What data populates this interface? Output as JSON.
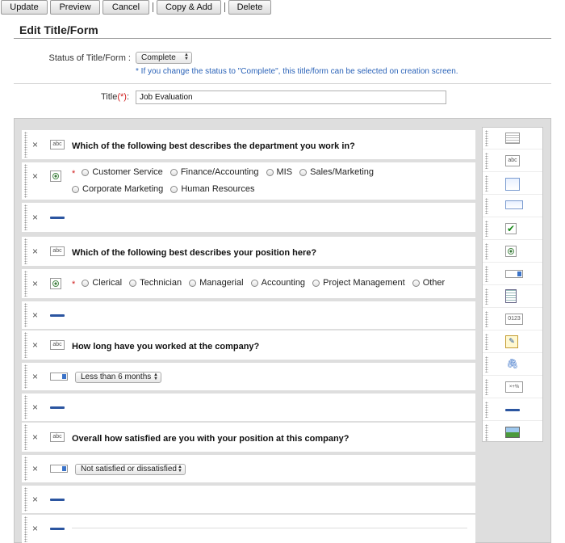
{
  "toolbar": {
    "update": "Update",
    "preview": "Preview",
    "cancel": "Cancel",
    "copy_add": "Copy & Add",
    "delete": "Delete"
  },
  "header": {
    "title": "Edit Title/Form"
  },
  "status": {
    "label": "Status of Title/Form :",
    "value": "Complete",
    "note": "* If you change the status to \"Complete\", this title/form can be selected on creation screen."
  },
  "title_field": {
    "label": "Title",
    "required_mark": "(*)",
    "colon": ":",
    "value": "Job Evaluation"
  },
  "icons": {
    "delete": "×",
    "abc": "abc",
    "num": "0123",
    "calc": "×+%",
    "check": "✔",
    "clip": "🖇",
    "note": "✎"
  },
  "questions": {
    "q1": {
      "text": "Which of the following best describes the department you work in?",
      "options": [
        "Customer Service",
        "Finance/Accounting",
        "MIS",
        "Sales/Marketing",
        "Corporate Marketing",
        "Human Resources"
      ]
    },
    "q2": {
      "text": "Which of the following best describes your position here?",
      "options": [
        "Clerical",
        "Technician",
        "Managerial",
        "Accounting",
        "Project Management",
        "Other"
      ]
    },
    "q3": {
      "text": "How long have you worked at the company?",
      "dropdown": "Less than 6 months"
    },
    "q4": {
      "text": "Overall how satisfied are you with your position at this company?",
      "dropdown": "Not satisfied or dissatisfied"
    }
  },
  "required_star": "*"
}
